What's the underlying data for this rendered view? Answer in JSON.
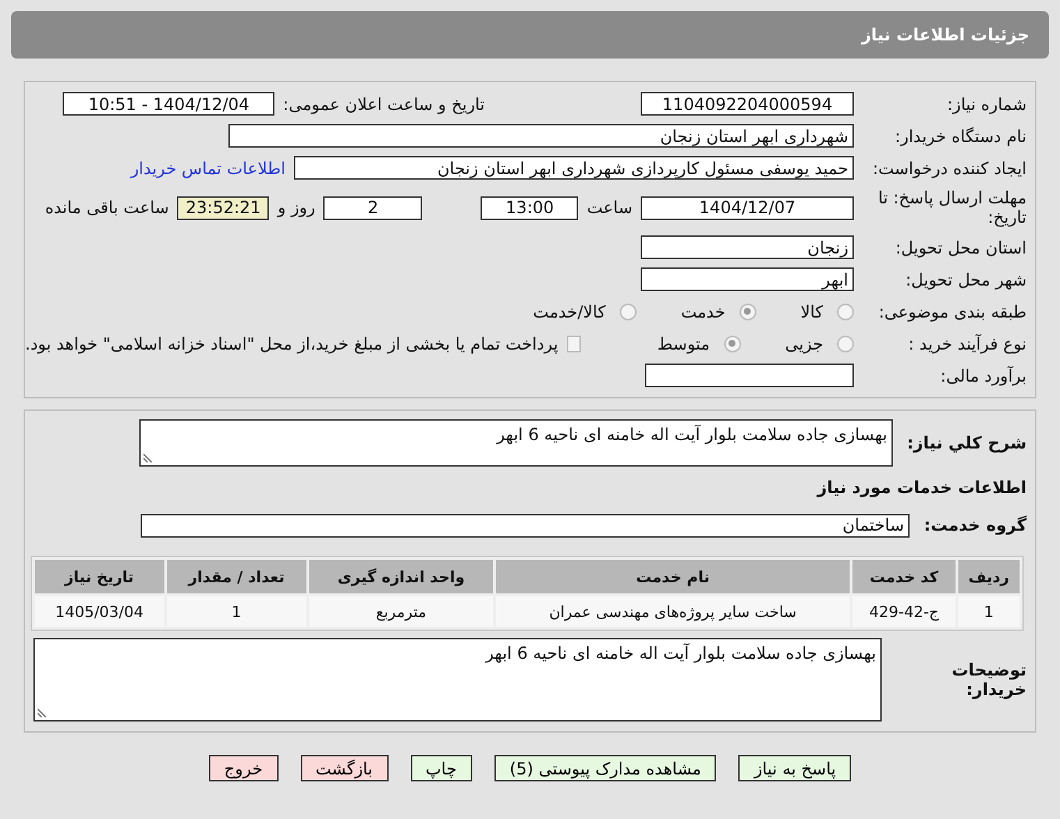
{
  "title": "جزئیات اطلاعات نیاز",
  "need_number": {
    "label": "شماره نیاز:",
    "value": "1104092204000594"
  },
  "announce": {
    "label": "تاریخ و ساعت اعلان عمومی:",
    "value": "1404/12/04 - 10:51"
  },
  "buyer": {
    "label": "نام دستگاه خریدار:",
    "value": "شهرداری ابهر استان زنجان"
  },
  "creator": {
    "label": "ایجاد کننده درخواست:",
    "value": "حمید یوسفی مسئول کارپردازی شهرداری ابهر استان زنجان",
    "link": "اطلاعات تماس خریدار"
  },
  "deadline": {
    "label": "مهلت ارسال پاسخ: تا تاریخ:",
    "date": "1404/12/07",
    "time_label": "ساعت",
    "time": "13:00",
    "days": "2",
    "days_label": "روز و",
    "remaining": "23:52:21",
    "remaining_label": "ساعت باقی مانده"
  },
  "province": {
    "label": "استان محل تحویل:",
    "value": "زنجان"
  },
  "city": {
    "label": "شهر محل تحویل:",
    "value": "ابهر"
  },
  "category": {
    "label": "طبقه بندی موضوعی:",
    "options": [
      {
        "label": "کالا",
        "selected": false
      },
      {
        "label": "خدمت",
        "selected": true
      },
      {
        "label": "کالا/خدمت",
        "selected": false
      }
    ]
  },
  "process": {
    "label": "نوع فرآیند خرید :",
    "options": [
      {
        "label": "جزیی",
        "selected": false
      },
      {
        "label": "متوسط",
        "selected": true
      }
    ],
    "payment": {
      "label": "پرداخت تمام یا بخشی از مبلغ خرید،از محل \"اسناد خزانه اسلامی\" خواهد بود.",
      "checked": false
    }
  },
  "estimate": {
    "label": "برآورد مالی:"
  },
  "description": {
    "label": "شرح کلي نیاز:",
    "value": "بهسازی جاده سلامت بلوار آیت اله خامنه ای ناحیه 6 ابهر"
  },
  "services_heading": "اطلاعات خدمات مورد نیاز",
  "service_group": {
    "label": "گروه خدمت:",
    "value": "ساختمان"
  },
  "table": {
    "columns": [
      "ردیف",
      "کد خدمت",
      "نام خدمت",
      "واحد اندازه گیری",
      "تعداد / مقدار",
      "تاریخ نیاز"
    ],
    "rows": [
      [
        "1",
        "ج-42-429",
        "ساخت سایر پروژه‌های مهندسی عمران",
        "مترمربع",
        "1",
        "1405/03/04"
      ]
    ]
  },
  "buyer_notes": {
    "label": "توضیحات خریدار:",
    "value": "بهسازی جاده سلامت بلوار آیت اله خامنه ای ناحیه 6 ابهر"
  },
  "buttons": [
    {
      "label": "پاسخ به نیاز",
      "kind": "green"
    },
    {
      "label": "مشاهده مدارک پیوستی (5)",
      "kind": "green"
    },
    {
      "label": "چاپ",
      "kind": "green"
    },
    {
      "label": "بازگشت",
      "kind": "red"
    },
    {
      "label": "خروج",
      "kind": "red"
    }
  ]
}
